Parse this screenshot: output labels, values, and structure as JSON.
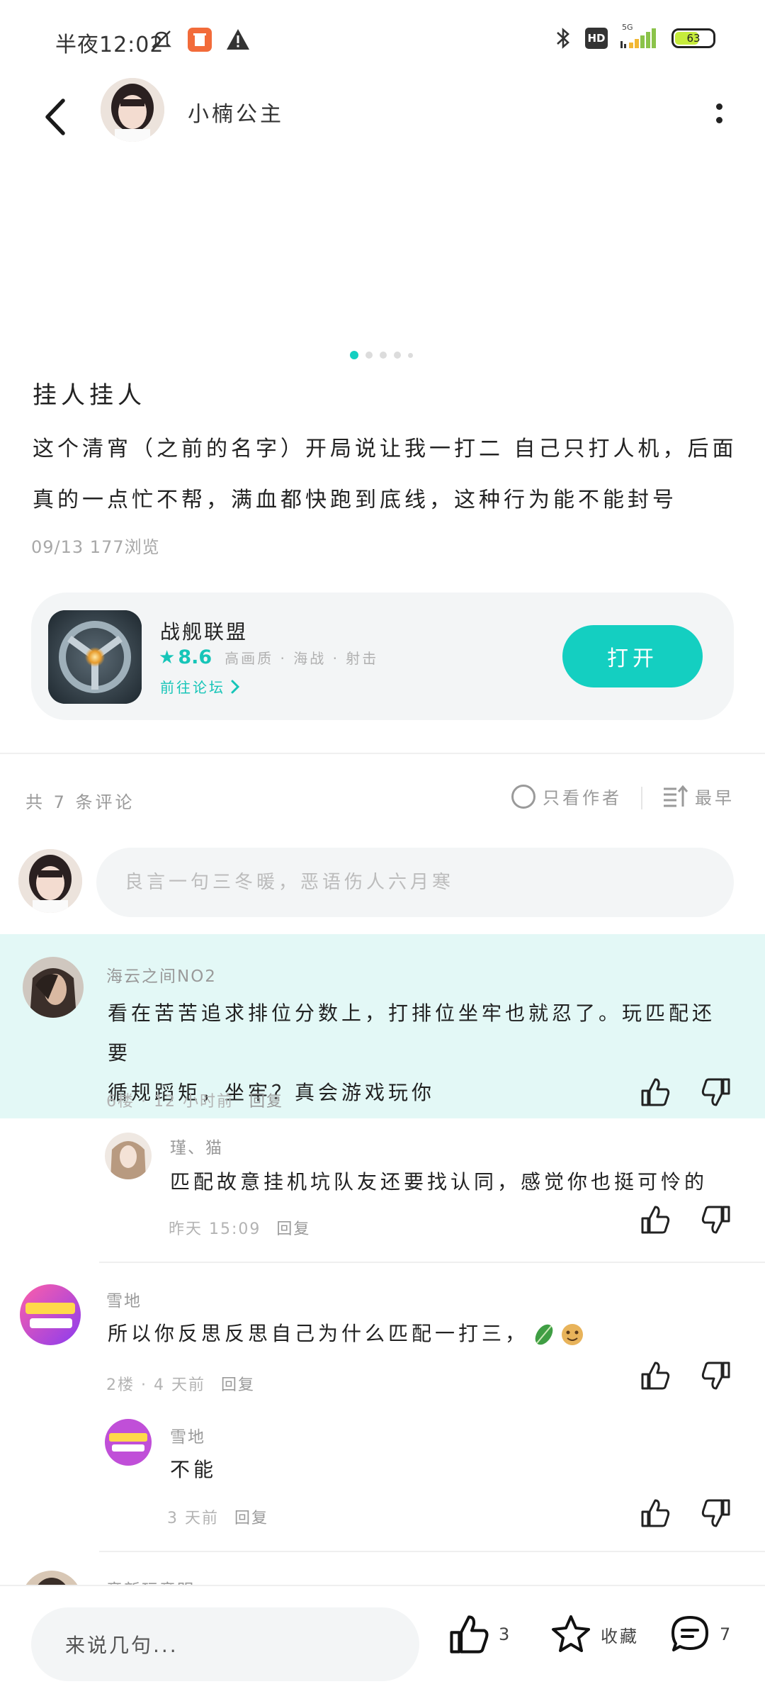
{
  "status": {
    "time": "半夜12:02",
    "battery": "63",
    "network_tag": "HD",
    "signal_label": "5G"
  },
  "header": {
    "author_name": "小楠公主"
  },
  "post": {
    "title": "挂人挂人",
    "body_line1": "这个清宵（之前的名字）开局说让我一打二 自己只打人机，后面",
    "body_line2": "真的一点忙不帮，满血都快跑到底线，这种行为能不能封号",
    "meta": "09/13  177浏览"
  },
  "game": {
    "name": "战舰联盟",
    "score": "8.6",
    "tags": "高画质 · 海战 · 射击",
    "forum_link": "前往论坛",
    "open_label": "打开"
  },
  "comments_header": {
    "count": "共 7 条评论",
    "author_only": "只看作者",
    "sort": "最早"
  },
  "composer": {
    "placeholder": "良言一句三冬暖，恶语伤人六月寒"
  },
  "comments": [
    {
      "name": "海云之间NO2",
      "text_line1": "看在苦苦追求排位分数上，打排位坐牢也就忍了。玩匹配还要",
      "text_line2": "循规蹈矩，坐牢？真会游戏玩你",
      "meta": "6楼 · 12 小时前",
      "reply": "回复"
    },
    {
      "name": "瑾、猫",
      "text_line1": "匹配故意挂机坑队友还要找认同，感觉你也挺可怜的",
      "meta": "昨天 15:09",
      "reply": "回复"
    },
    {
      "name": "雪地",
      "text_line1": "所以你反思反思自己为什么匹配一打三，",
      "meta": "2楼 · 4 天前",
      "reply": "回复"
    },
    {
      "name": "雪地",
      "text_line1": "不能",
      "meta": "3 天前",
      "reply": "回复"
    },
    {
      "name": "竞新玩竞明"
    }
  ],
  "bottom_bar": {
    "input_placeholder": "来说几句...",
    "like_count": "3",
    "favorite_label": "收藏",
    "comment_count": "7"
  },
  "colors": {
    "accent": "#14cfc1",
    "highlight_bg": "#e3f8f6",
    "card_bg": "#f3f5f6"
  }
}
